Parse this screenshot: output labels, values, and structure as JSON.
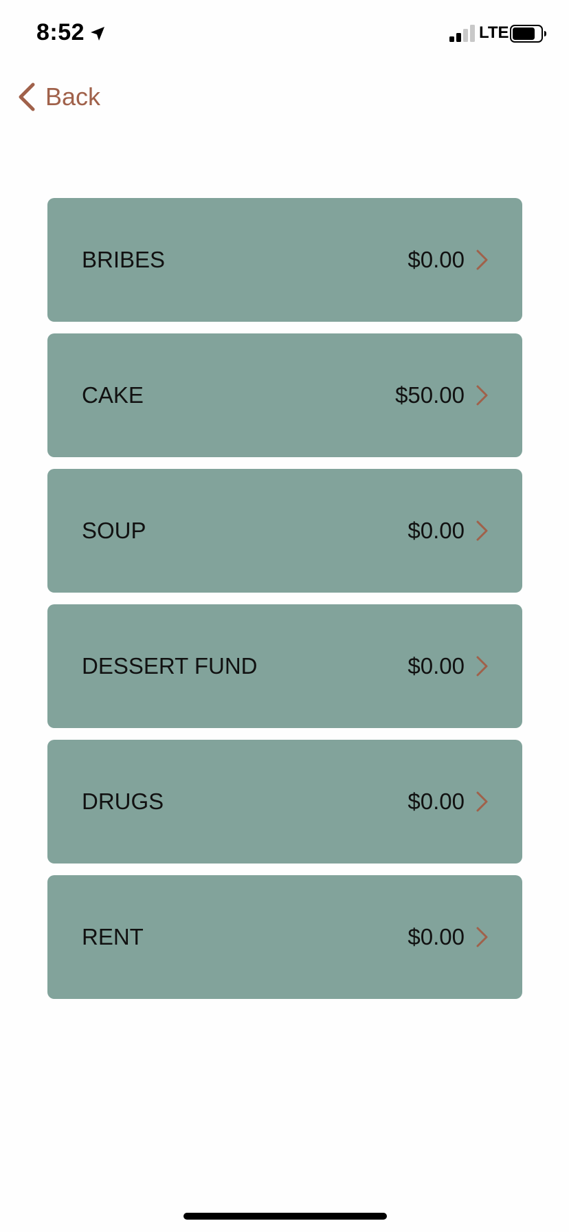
{
  "status_bar": {
    "time": "8:52",
    "network": "LTE",
    "signal_bars_filled": 2,
    "signal_bars_total": 4,
    "battery_level": 0.8
  },
  "nav": {
    "back_label": "Back"
  },
  "colors": {
    "accent": "#a0614a",
    "card_background": "#82a39b",
    "background": "#fefefe"
  },
  "categories": [
    {
      "name": "BRIBES",
      "amount": "$0.00"
    },
    {
      "name": "CAKE",
      "amount": "$50.00"
    },
    {
      "name": "SOUP",
      "amount": "$0.00"
    },
    {
      "name": "DESSERT FUND",
      "amount": "$0.00"
    },
    {
      "name": "DRUGS",
      "amount": "$0.00"
    },
    {
      "name": "RENT",
      "amount": "$0.00"
    }
  ]
}
